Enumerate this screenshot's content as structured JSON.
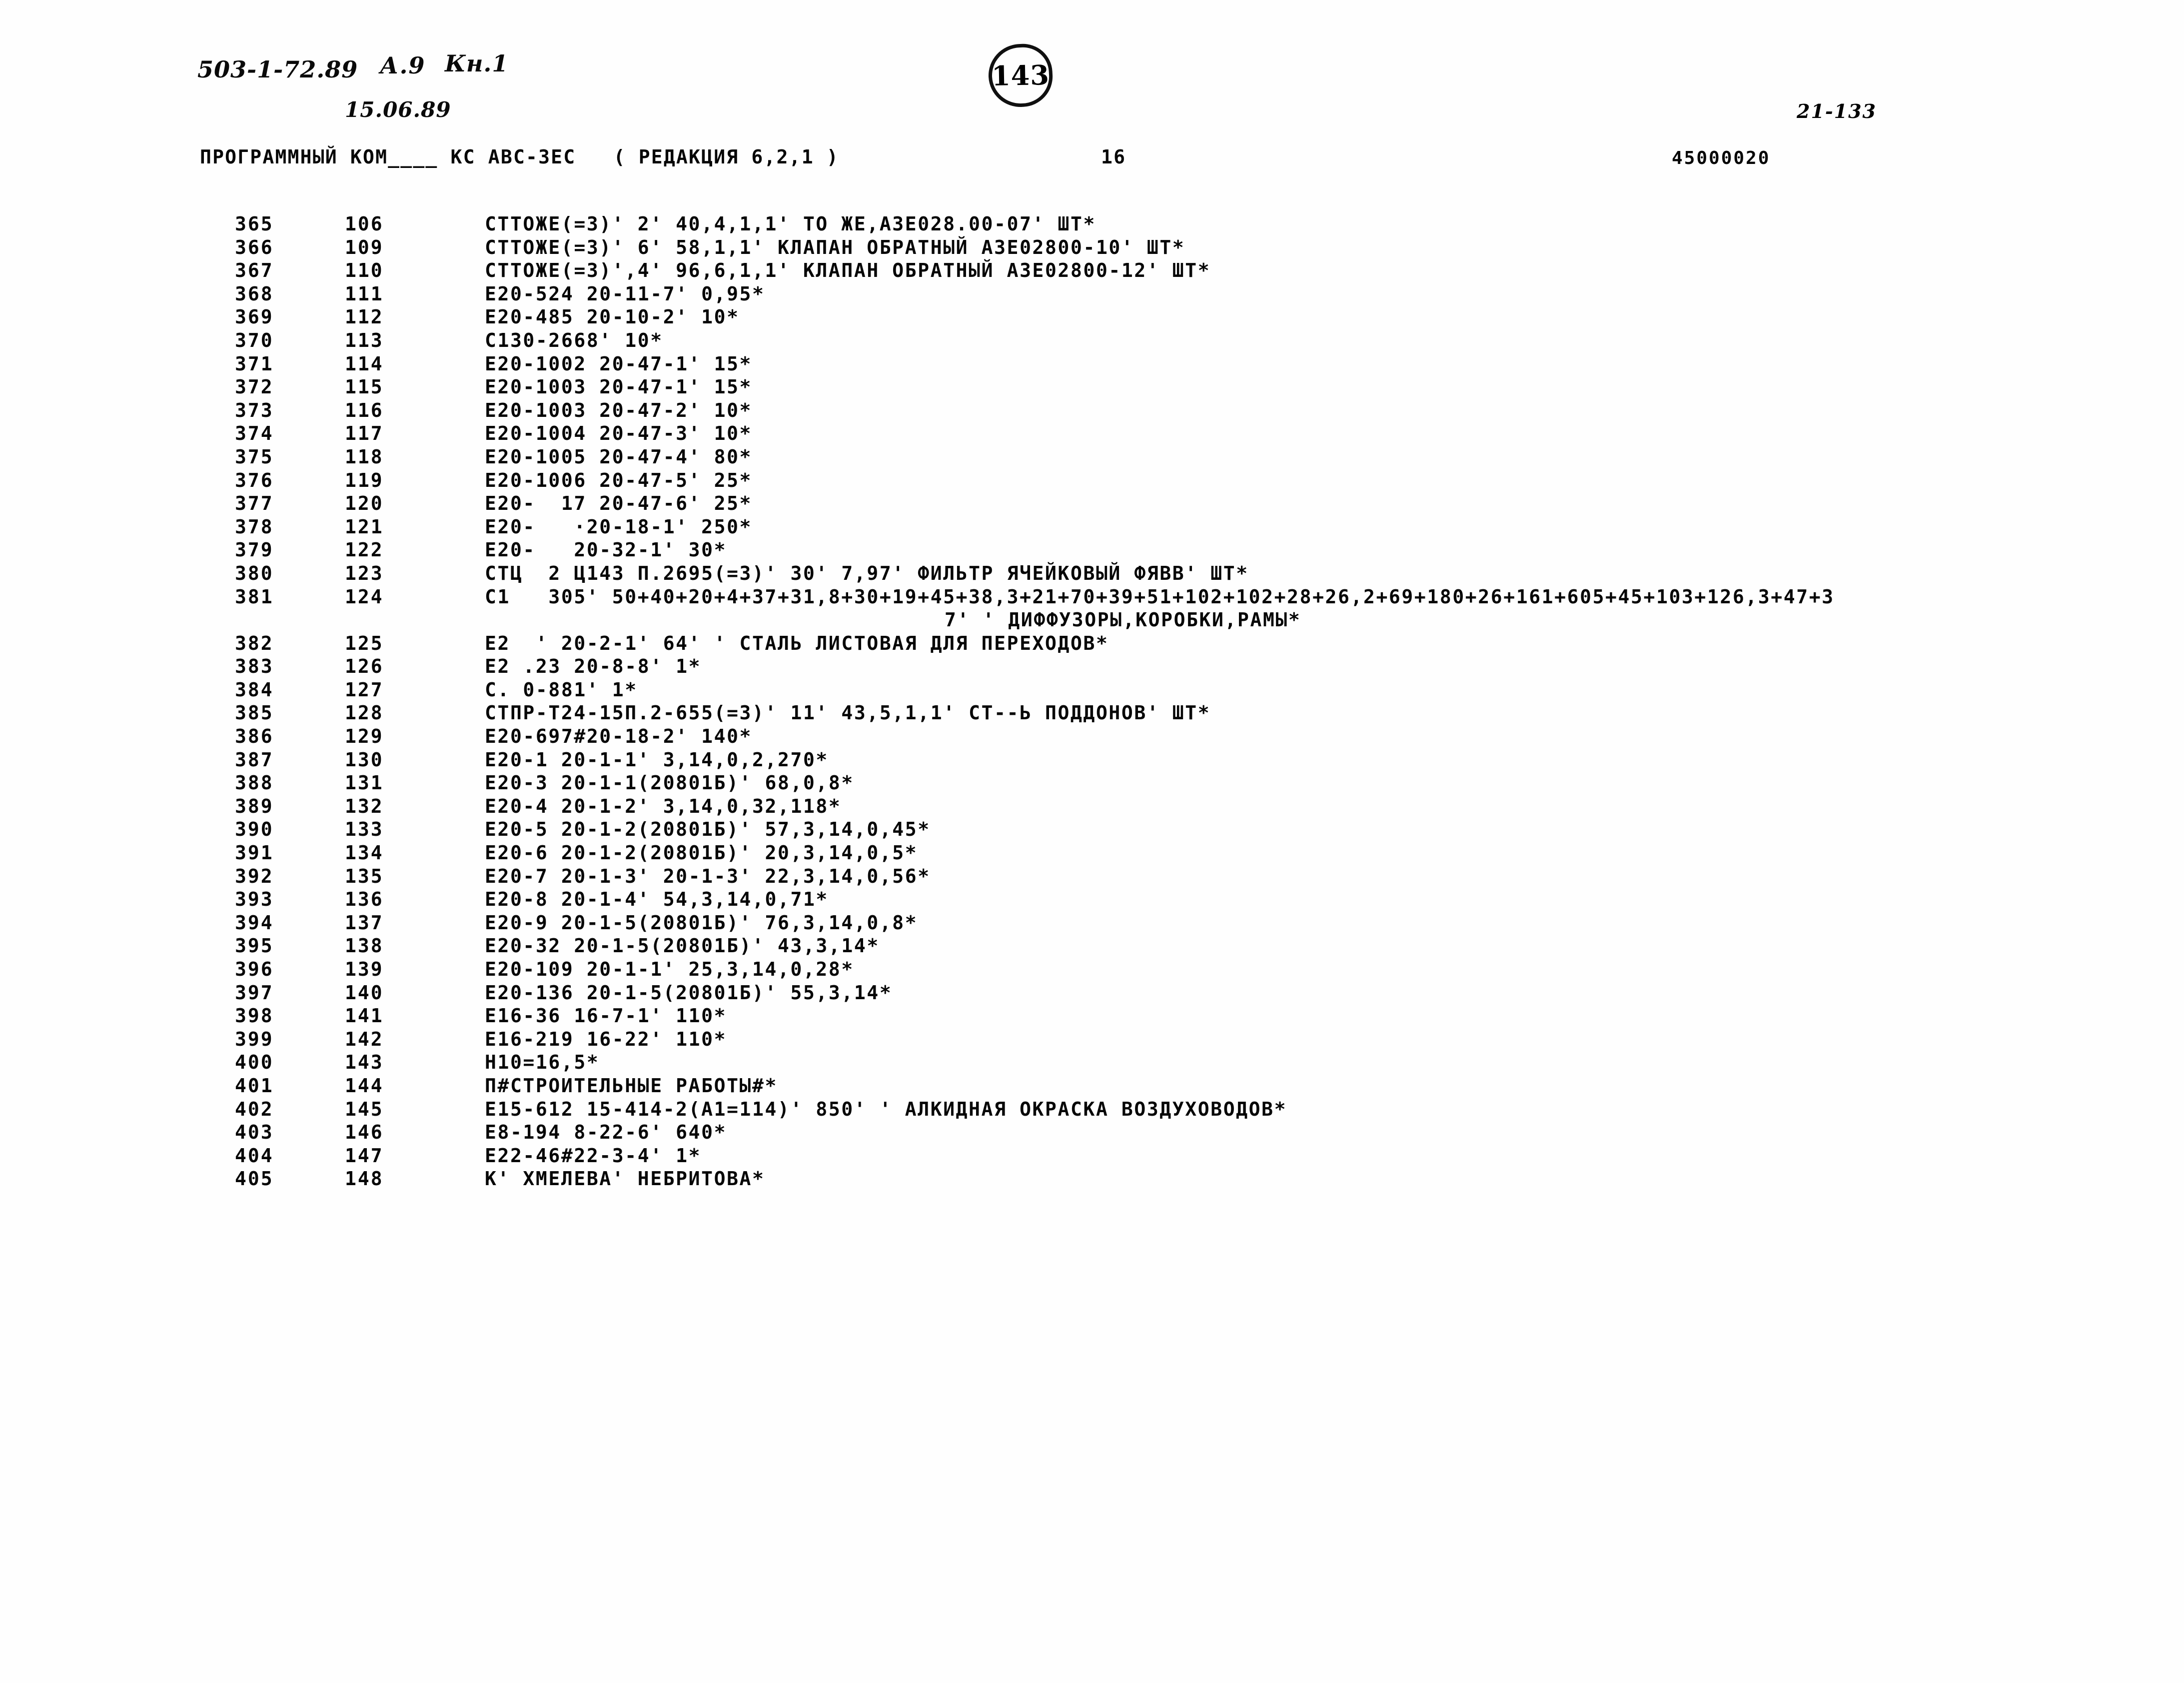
{
  "annotations": {
    "doc_code": "503-1-72.89",
    "album": "А.9",
    "book": "Кн.1",
    "date": "15.06.89",
    "page_number": "143",
    "sheet_code": "21-133"
  },
  "header": {
    "program_title": "ПРОГРАММНЫЙ КОМ____ КС АВС-3ЕС   ( РЕДАКЦИЯ 6,2,1 )",
    "sheet_no": "16",
    "object_code": "45000020"
  },
  "listing": {
    "rows": [
      {
        "no": "365",
        "seq": "106",
        "text": "СТТОЖЕ(=3)' 2' 40,4,1,1' ТО ЖЕ,АЗЕ028.00-07' ШТ*"
      },
      {
        "no": "366",
        "seq": "109",
        "text": "СТТОЖЕ(=3)' 6' 58,1,1' КЛАПАН ОБРАТНЫЙ АЗЕ02800-10' ШТ*"
      },
      {
        "no": "367",
        "seq": "110",
        "text": "СТТОЖЕ(=3)',4' 96,6,1,1' КЛАПАН ОБРАТНЫЙ АЗЕ02800-12' ШТ*"
      },
      {
        "no": "368",
        "seq": "111",
        "text": "Е20-524 20-11-7' 0,95*"
      },
      {
        "no": "369",
        "seq": "112",
        "text": "Е20-485 20-10-2' 10*"
      },
      {
        "no": "370",
        "seq": "113",
        "text": "С130-2668' 10*"
      },
      {
        "no": "371",
        "seq": "114",
        "text": "Е20-1002 20-47-1' 15*"
      },
      {
        "no": "372",
        "seq": "115",
        "text": "Е20-1003 20-47-1' 15*"
      },
      {
        "no": "373",
        "seq": "116",
        "text": "Е20-1003 20-47-2' 10*"
      },
      {
        "no": "374",
        "seq": "117",
        "text": "Е20-1004 20-47-3' 10*"
      },
      {
        "no": "375",
        "seq": "118",
        "text": "Е20-1005 20-47-4' 80*"
      },
      {
        "no": "376",
        "seq": "119",
        "text": "Е20-1006 20-47-5' 25*"
      },
      {
        "no": "377",
        "seq": "120",
        "text": "Е20-  17 20-47-6' 25*"
      },
      {
        "no": "378",
        "seq": "121",
        "text": "Е20-   ·20-18-1' 250*"
      },
      {
        "no": "379",
        "seq": "122",
        "text": "Е20-   20-32-1' 30*"
      },
      {
        "no": "380",
        "seq": "123",
        "text": "СТЦ  2 Ц143 П.2695(=3)' 30' 7,97' ФИЛЬТР ЯЧЕЙКОВЫЙ ФЯВВ' ШТ*"
      },
      {
        "no": "381",
        "seq": "124",
        "text": "С1   305' 50+40+20+4+37+31,8+30+19+45+38,3+21+70+39+51+102+102+28+26,2+69+180+26+161+605+45+103+126,3+47+3"
      },
      {
        "no": "",
        "seq": "",
        "cont": true,
        "text": "7' ' ДИФФУЗОРЫ,КОРОБКИ,РАМЫ*"
      },
      {
        "no": "382",
        "seq": "125",
        "text": "Е2  ' 20-2-1' 64' ' СТАЛЬ ЛИСТОВАЯ ДЛЯ ПЕРЕХОДОВ*"
      },
      {
        "no": "383",
        "seq": "126",
        "text": "Е2 .23 20-8-8' 1*"
      },
      {
        "no": "384",
        "seq": "127",
        "text": "С. 0-881' 1*"
      },
      {
        "no": "385",
        "seq": "128",
        "text": "СТПР-Т24-15П.2-655(=3)' 11' 43,5,1,1' СТ--Ь ПОДДОНОВ' ШТ*"
      },
      {
        "no": "386",
        "seq": "129",
        "text": "Е20-697#20-18-2' 140*"
      },
      {
        "no": "387",
        "seq": "130",
        "text": "Е20-1 20-1-1' 3,14,0,2,270*"
      },
      {
        "no": "388",
        "seq": "131",
        "text": "Е20-3 20-1-1(20801Б)' 68,0,8*"
      },
      {
        "no": "389",
        "seq": "132",
        "text": "Е20-4 20-1-2' 3,14,0,32,118*"
      },
      {
        "no": "390",
        "seq": "133",
        "text": "Е20-5 20-1-2(20801Б)' 57,3,14,0,45*"
      },
      {
        "no": "391",
        "seq": "134",
        "text": "Е20-6 20-1-2(20801Б)' 20,3,14,0,5*"
      },
      {
        "no": "392",
        "seq": "135",
        "text": "Е20-7 20-1-3' 20-1-3' 22,3,14,0,56*"
      },
      {
        "no": "393",
        "seq": "136",
        "text": "Е20-8 20-1-4' 54,3,14,0,71*"
      },
      {
        "no": "394",
        "seq": "137",
        "text": "Е20-9 20-1-5(20801Б)' 76,3,14,0,8*"
      },
      {
        "no": "395",
        "seq": "138",
        "text": "Е20-32 20-1-5(20801Б)' 43,3,14*"
      },
      {
        "no": "396",
        "seq": "139",
        "text": "Е20-109 20-1-1' 25,3,14,0,28*"
      },
      {
        "no": "397",
        "seq": "140",
        "text": "Е20-136 20-1-5(20801Б)' 55,3,14*"
      },
      {
        "no": "398",
        "seq": "141",
        "text": "Е16-36 16-7-1' 110*"
      },
      {
        "no": "399",
        "seq": "142",
        "text": "Е16-219 16-22' 110*"
      },
      {
        "no": "400",
        "seq": "143",
        "text": "Н10=16,5*"
      },
      {
        "no": "401",
        "seq": "144",
        "text": "П#СТРОИТЕЛЬНЫЕ РАБОТЫ#*"
      },
      {
        "no": "402",
        "seq": "145",
        "text": "Е15-612 15-414-2(А1=114)' 850' ' АЛКИДНАЯ ОКРАСКА ВОЗДУХОВОДОВ*"
      },
      {
        "no": "403",
        "seq": "146",
        "text": "Е8-194 8-22-6' 640*"
      },
      {
        "no": "404",
        "seq": "147",
        "text": "Е22-46#22-3-4' 1*"
      },
      {
        "no": "405",
        "seq": "148",
        "text": "К' ХМЕЛЕВА' НЕБРИТОВА*"
      }
    ]
  }
}
